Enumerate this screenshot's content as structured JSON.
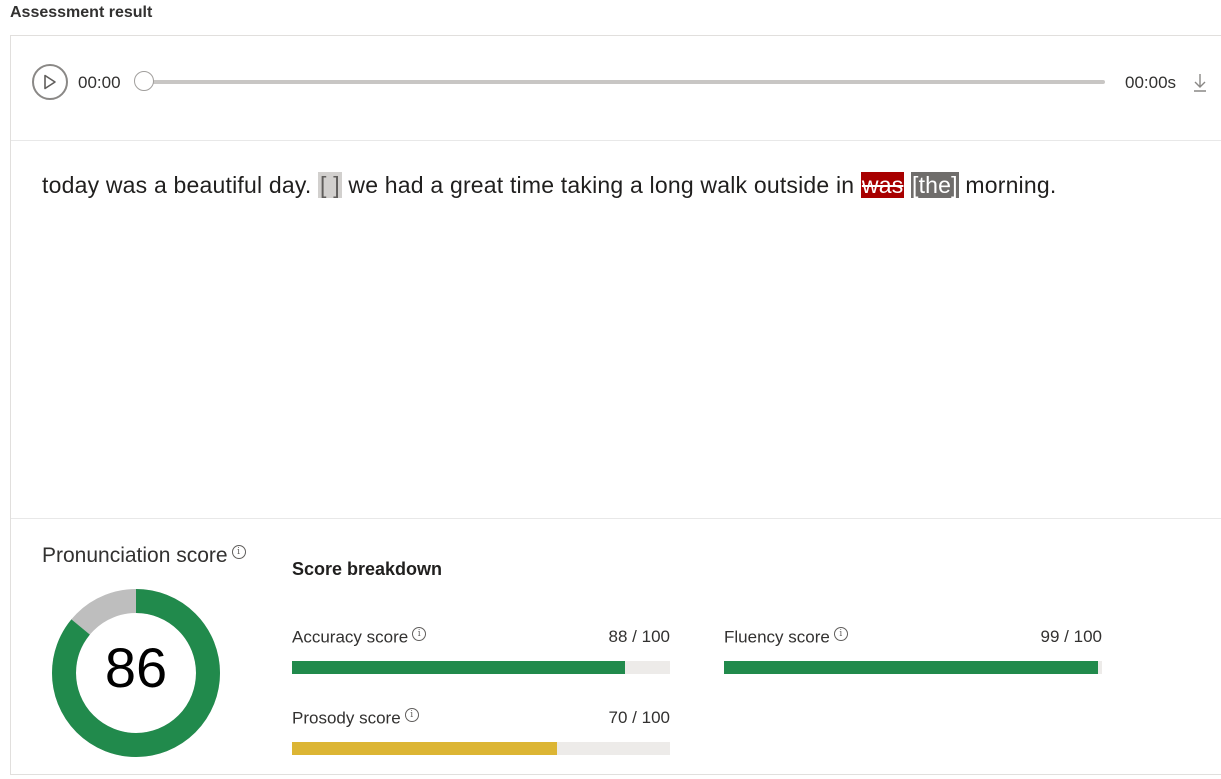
{
  "page": {
    "title": "Assessment result"
  },
  "player": {
    "current_time": "00:00",
    "duration": "00:00s",
    "progress": 0
  },
  "transcript": {
    "segments": [
      {
        "text": "today was a beautiful day. ",
        "kind": "normal"
      },
      {
        "text": "[ ]",
        "kind": "pause"
      },
      {
        "text": " we had a great time taking a long walk outside in ",
        "kind": "normal"
      },
      {
        "text": "was",
        "kind": "error"
      },
      {
        "text": " ",
        "kind": "normal"
      },
      {
        "text": "[the]",
        "kind": "insert"
      },
      {
        "text": " morning.",
        "kind": "normal"
      }
    ]
  },
  "scores": {
    "pronunciation_label": "Pronunciation score",
    "pronunciation_value": "86",
    "pronunciation_fraction": 0.86,
    "breakdown_title": "Score breakdown",
    "metrics": [
      {
        "label": "Accuracy score",
        "value_text": "88 / 100",
        "value": 88,
        "color": "#218a4c"
      },
      {
        "label": "Fluency score",
        "value_text": "99 / 100",
        "value": 99,
        "color": "#218a4c"
      },
      {
        "label": "Prosody score",
        "value_text": "70 / 100",
        "value": 70,
        "color": "#dcb534"
      }
    ]
  },
  "colors": {
    "good": "#218a4c",
    "warning": "#dcb534",
    "error": "#a80000",
    "track": "#edebe9",
    "donut_rest": "#bebebe"
  },
  "icons": {
    "play": "play-icon",
    "download": "download-icon",
    "info": "info-icon"
  }
}
